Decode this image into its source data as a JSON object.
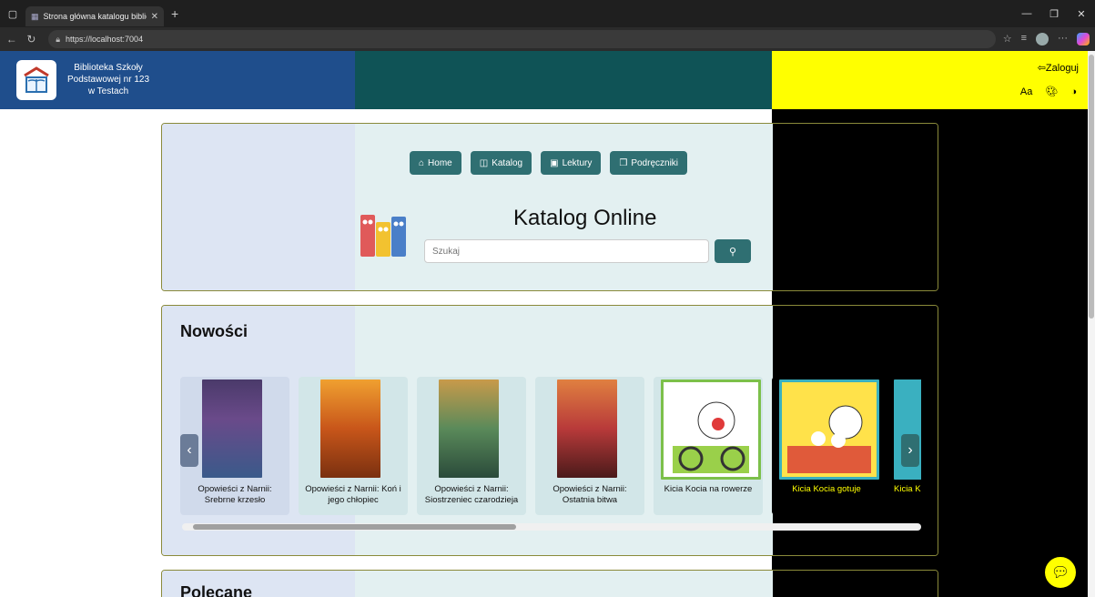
{
  "browser": {
    "tab_title": "Strona główna katalogu biblioteki",
    "url": "https://localhost:7004"
  },
  "header": {
    "library_name_line1": "Biblioteka Szkoły",
    "library_name_line2": "Podstawowej nr 123",
    "library_name_line3": "w Testach",
    "login_label": "Zaloguj",
    "font_size_label": "Aa"
  },
  "hero": {
    "nav": [
      {
        "label": "Home",
        "icon": "home-icon"
      },
      {
        "label": "Katalog",
        "icon": "book-open-icon"
      },
      {
        "label": "Lektury",
        "icon": "bookmark-icon"
      },
      {
        "label": "Podręczniki",
        "icon": "copy-icon"
      }
    ],
    "title": "Katalog Online",
    "search_placeholder": "Szukaj"
  },
  "news": {
    "title": "Nowości",
    "books": [
      {
        "title": "Opowieści z Narnii: Srebrne krzesło",
        "cover_color": "#6a4a8a"
      },
      {
        "title": "Opowieści z Narnii: Koń i jego chłopiec",
        "cover_color": "#c8561a"
      },
      {
        "title": "Opowieści z Narnii: Siostrzeniec czarodzieja",
        "cover_color": "#5a8a5a"
      },
      {
        "title": "Opowieści z Narnii: Ostatnia bitwa",
        "cover_color": "#b83a3a"
      },
      {
        "title": "Kicia Kocia na rowerze",
        "cover_color": "#7cc04a"
      },
      {
        "title": "Kicia Kocia gotuje",
        "cover_color": "#ffd23a"
      },
      {
        "title": "Kicia Kocia",
        "cover_color": "#3ab0c0"
      }
    ]
  },
  "recommended": {
    "title": "Polecane"
  },
  "colors": {
    "header_blue": "#1f4e8c",
    "header_teal": "#0f5356",
    "header_yellow": "#ffff00",
    "button_teal": "#2f6f72"
  }
}
